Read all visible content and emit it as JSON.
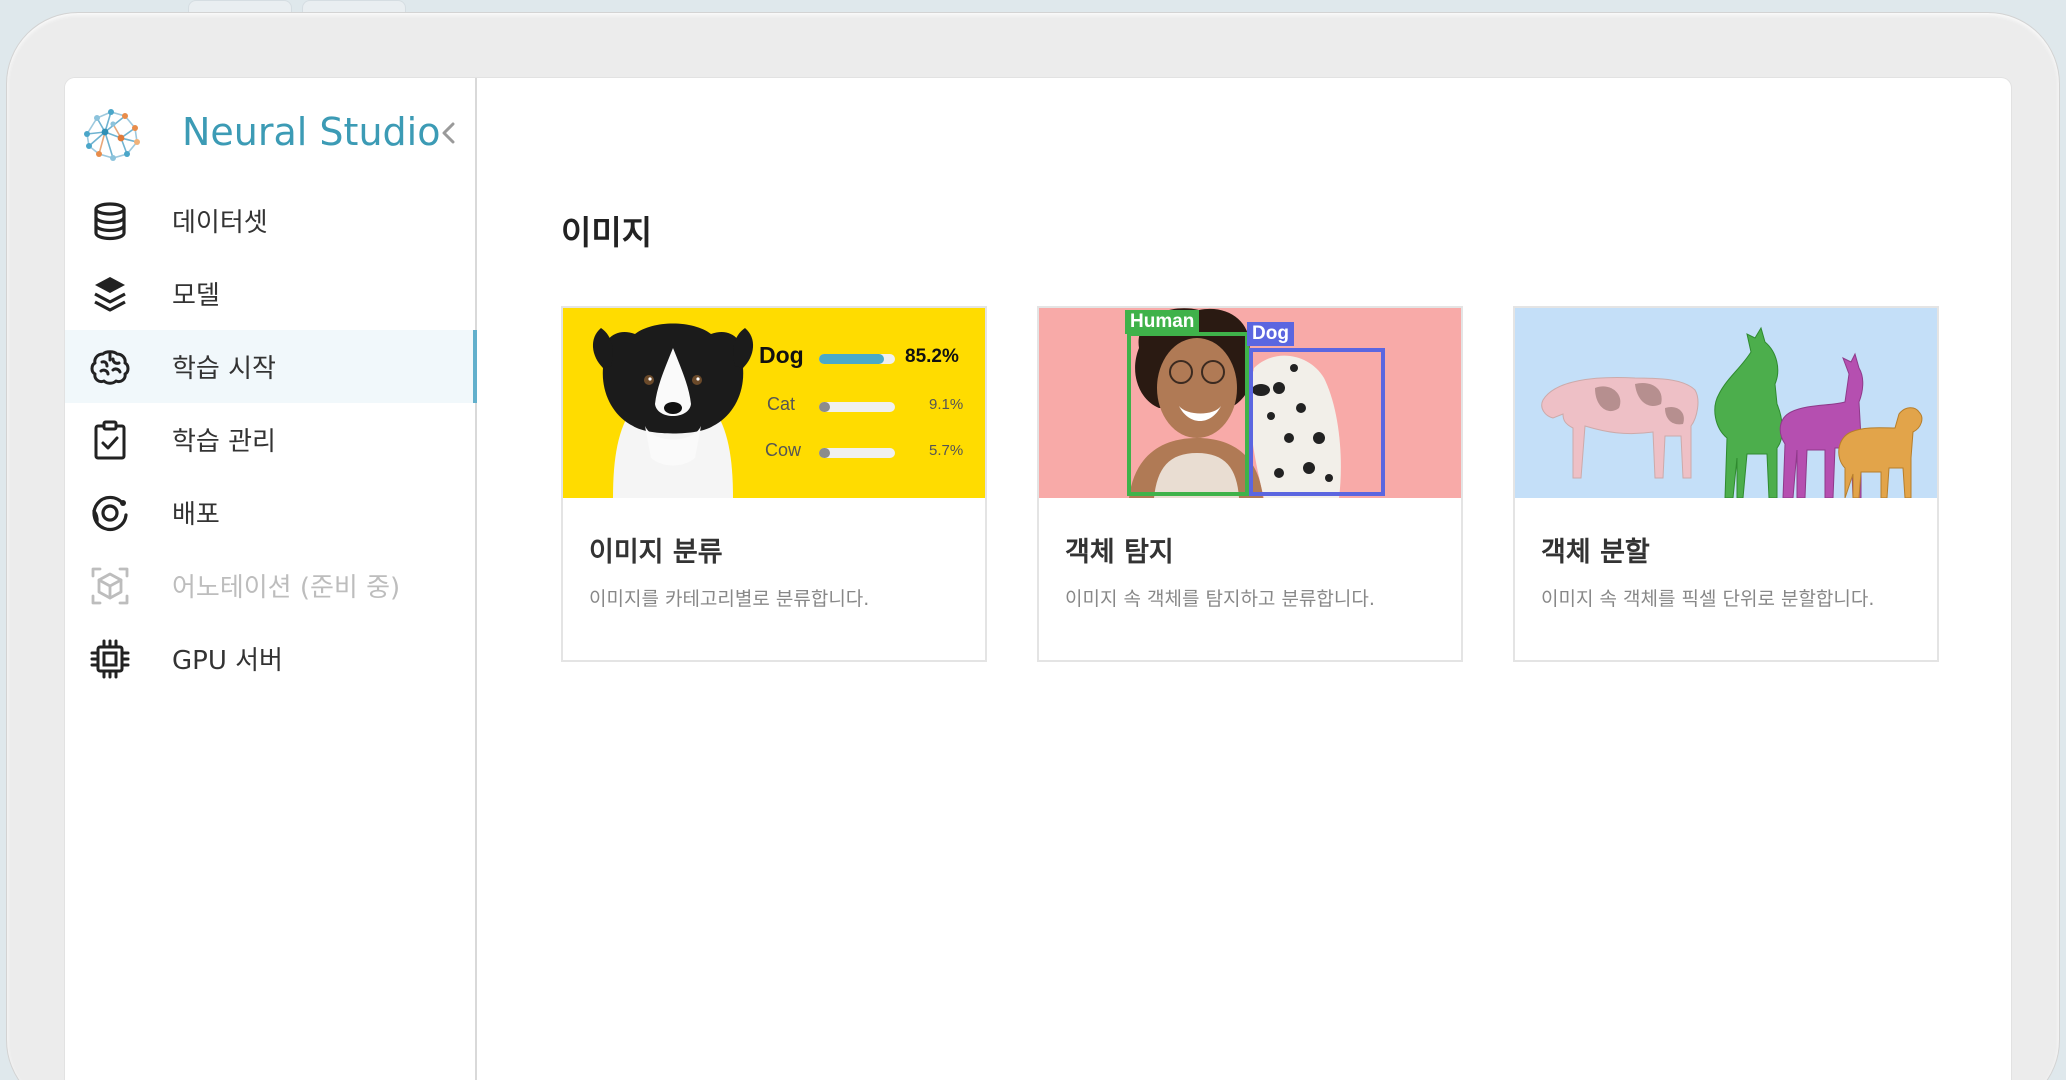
{
  "brand": {
    "name": "Neural Studio"
  },
  "sidebar": {
    "items": [
      {
        "label": "데이터셋",
        "icon": "database-icon",
        "active": false,
        "disabled": false
      },
      {
        "label": "모델",
        "icon": "layers-icon",
        "active": false,
        "disabled": false
      },
      {
        "label": "학습 시작",
        "icon": "brain-icon",
        "active": true,
        "disabled": false
      },
      {
        "label": "학습 관리",
        "icon": "clipboard-check-icon",
        "active": false,
        "disabled": false
      },
      {
        "label": "배포",
        "icon": "deploy-orbit-icon",
        "active": false,
        "disabled": false
      },
      {
        "label": "어노테이션 (준비 중)",
        "icon": "cube-scan-icon",
        "active": false,
        "disabled": true
      },
      {
        "label": "GPU 서버",
        "icon": "chip-icon",
        "active": false,
        "disabled": false
      }
    ]
  },
  "main": {
    "title": "이미지",
    "cards": [
      {
        "title": "이미지 분류",
        "description": "이미지를 카테고리별로 분류합니다.",
        "preview": {
          "background": "#ffdc00",
          "classes": [
            {
              "name": "Dog",
              "percent": "85.2%",
              "value": 0.852
            },
            {
              "name": "Cat",
              "percent": "9.1%",
              "value": 0.091
            },
            {
              "name": "Cow",
              "percent": "5.7%",
              "value": 0.057
            }
          ]
        }
      },
      {
        "title": "객체 탐지",
        "description": "이미지 속 객체를 탐지하고 분류합니다.",
        "preview": {
          "background": "#f8aaa8",
          "boxes": [
            {
              "label": "Human",
              "color": "#3fb24a"
            },
            {
              "label": "Dog",
              "color": "#5b66e0"
            }
          ]
        }
      },
      {
        "title": "객체 분할",
        "description": "이미지 속 객체를 픽셀 단위로 분할합니다.",
        "preview": {
          "background": "#c4dff8"
        }
      }
    ]
  },
  "colors": {
    "accent": "#3c9bb5",
    "active_bar": "#62b0cc",
    "active_bg": "#f1f8fb"
  }
}
